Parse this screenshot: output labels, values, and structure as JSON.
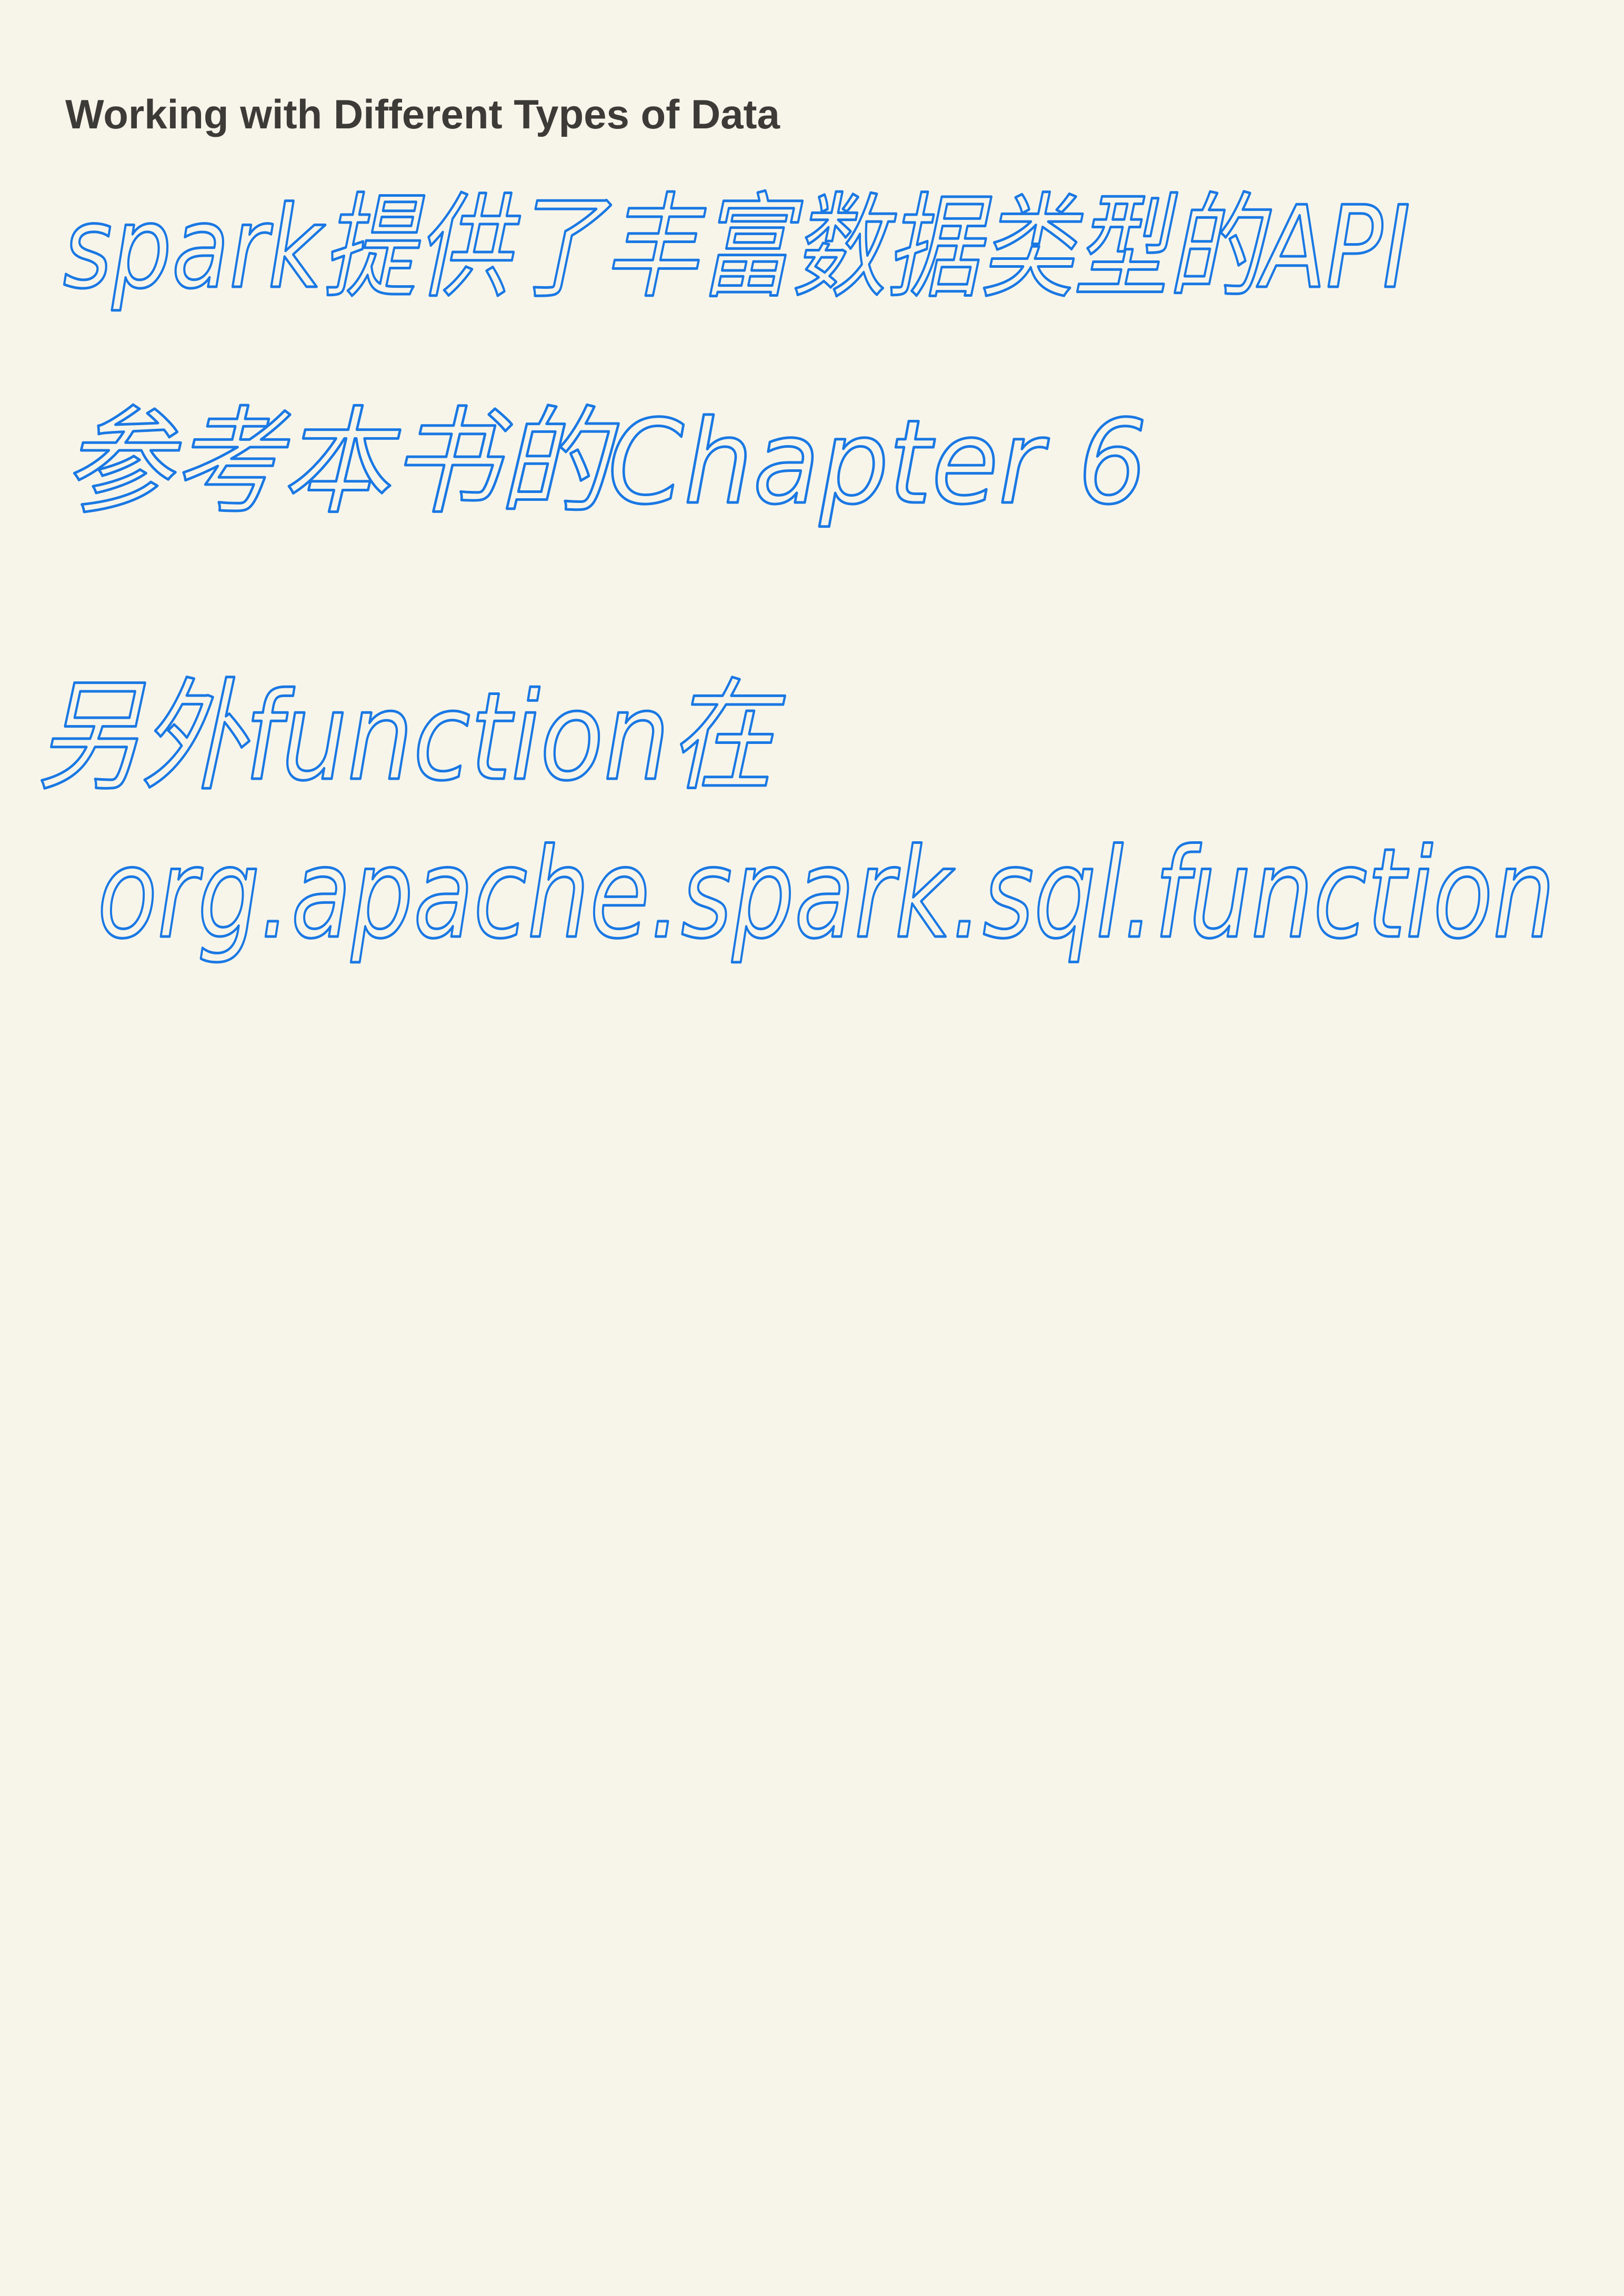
{
  "note": {
    "title": "Working with Different Types of Data",
    "handwritten_lines": [
      "spark提供了丰富数据类型的API",
      "参考本书的Chapter 6",
      "另外function在",
      "org.apache.spark.sql.function"
    ]
  },
  "colors": {
    "background": "#f7f5ea",
    "title_text": "#3c3b37",
    "ink": "#1a78e3"
  }
}
